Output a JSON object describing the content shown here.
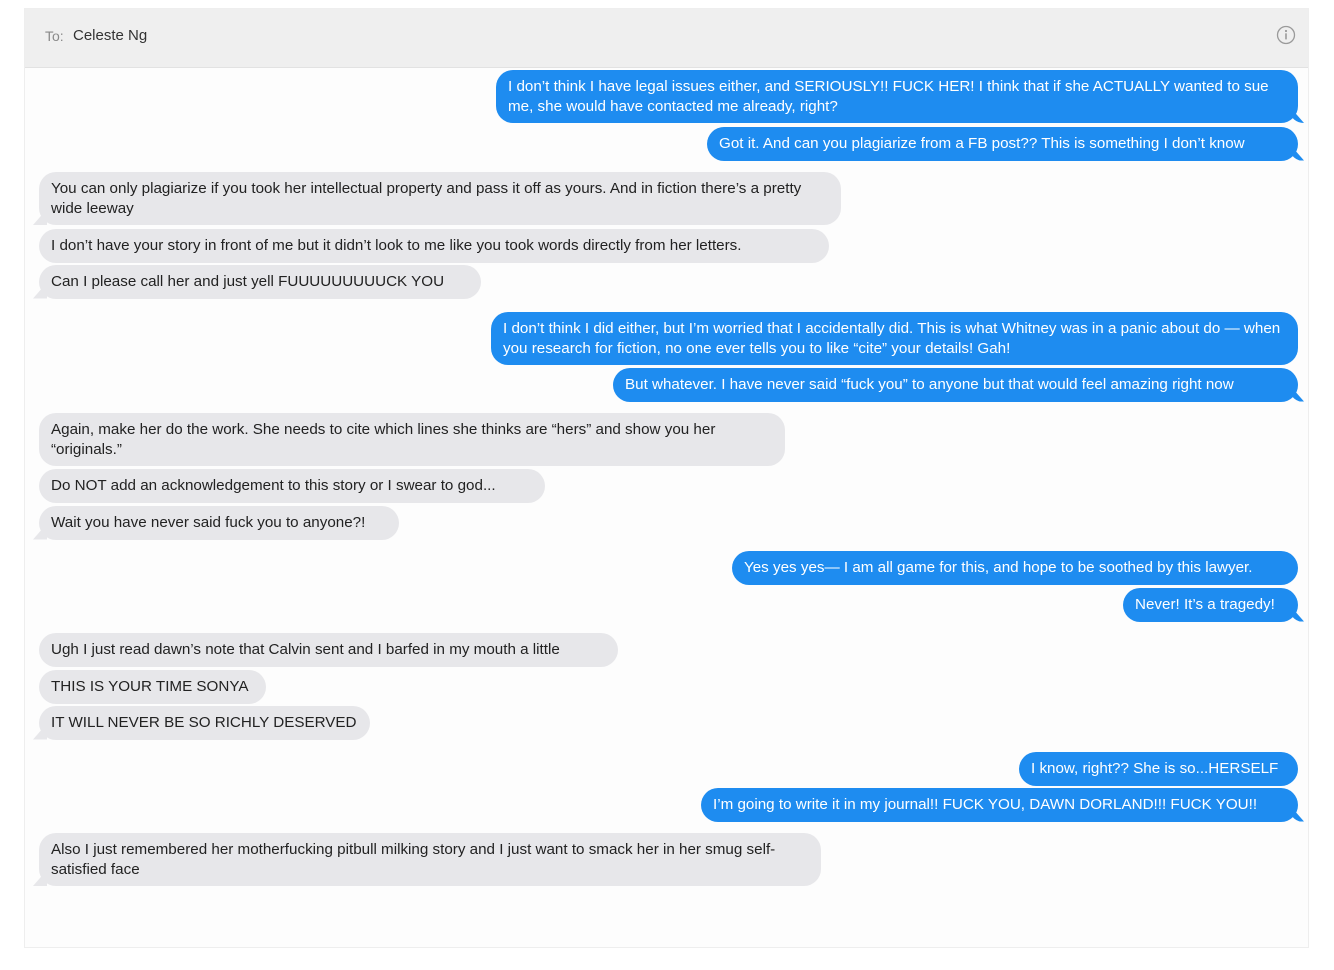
{
  "header": {
    "to_label": "To:",
    "recipient": "Celeste Ng",
    "info_icon": "info-circle-icon"
  },
  "colors": {
    "sent_bubble": "#1e8cf0",
    "received_bubble": "#e7e7ea"
  },
  "messages": [
    {
      "from": "me",
      "text": "I don’t think I have legal issues either, and SERIOUSLY!! FUCK HER! I think that if she ACTUALLY wanted to sue me, she would have contacted me already, right?"
    },
    {
      "from": "me",
      "text": "Got it. And can you plagiarize from a FB post?? This is something I don’t know"
    },
    {
      "from": "them",
      "text": "You can only plagiarize if you took her intellectual property and pass it off as yours. And in fiction there’s a pretty wide leeway"
    },
    {
      "from": "them",
      "text": "I don’t have your story in front of me but it didn’t look to me like you took words directly from her letters."
    },
    {
      "from": "them",
      "text": "Can I please call her and just yell FUUUUUUUUUCK YOU"
    },
    {
      "from": "me",
      "text": "I don’t think I did either, but I’m worried that I accidentally did. This is what Whitney was in a panic about do — when you research for fiction, no one ever tells you to like “cite” your details! Gah!"
    },
    {
      "from": "me",
      "text": "But whatever. I have never said “fuck you” to anyone but that would feel amazing right now"
    },
    {
      "from": "them",
      "text": "Again, make her do the work. She needs to cite which lines she thinks are “hers” and show you her “originals.”"
    },
    {
      "from": "them",
      "text": "Do NOT add an acknowledgement to this story or I swear to god..."
    },
    {
      "from": "them",
      "text": "Wait you have never said fuck you to anyone?!"
    },
    {
      "from": "me",
      "text": "Yes yes yes— I am all game for this, and hope to be soothed by this lawyer."
    },
    {
      "from": "me",
      "text": "Never! It’s a tragedy!"
    },
    {
      "from": "them",
      "text": "Ugh I just read dawn’s note that Calvin sent and I barfed in my mouth a little"
    },
    {
      "from": "them",
      "text": "THIS IS YOUR TIME SONYA"
    },
    {
      "from": "them",
      "text": "IT WILL NEVER BE SO RICHLY DESERVED"
    },
    {
      "from": "me",
      "text": "I know, right?? She is so...HERSELF"
    },
    {
      "from": "me",
      "text": "I’m going to write it in my journal!! FUCK YOU, DAWN DORLAND!!! FUCK YOU!!"
    },
    {
      "from": "them",
      "text": "Also I just remembered her motherfucking pitbull milking story and I just want to smack her in her smug self-satisfied face"
    }
  ]
}
